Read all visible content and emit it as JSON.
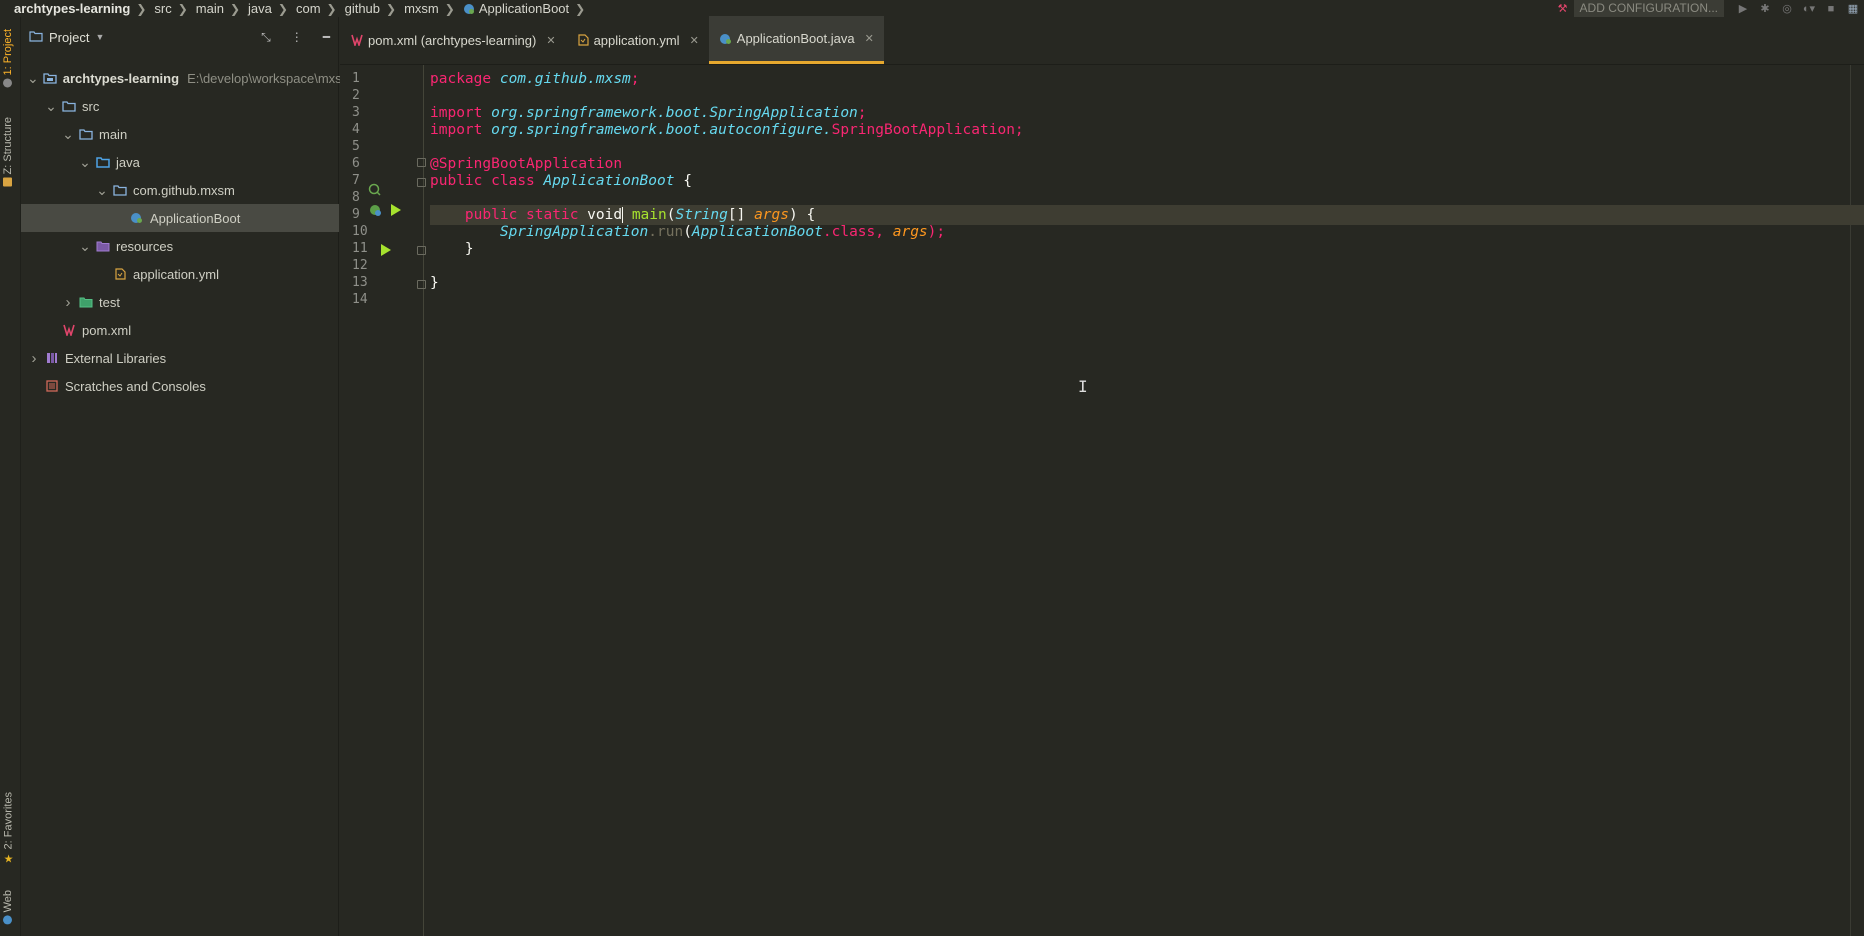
{
  "breadcrumb": [
    "archtypes-learning",
    "src",
    "main",
    "java",
    "com",
    "github",
    "mxsm",
    "ApplicationBoot"
  ],
  "toolbar": {
    "add_configuration": "ADD CONFIGURATION..."
  },
  "left_strip": {
    "project_tab": "1: Project",
    "structure_tab": "Z: Structure",
    "favorites_tab": "2: Favorites",
    "web_tab": "Web"
  },
  "project_panel": {
    "title": "Project",
    "tree": [
      {
        "label": "archtypes-learning",
        "path": "E:\\develop\\workspace\\mxs",
        "indent": 0,
        "arrow": "down",
        "icon": "module-folder-icon"
      },
      {
        "label": "src",
        "indent": 1,
        "arrow": "down",
        "icon": "folder-icon"
      },
      {
        "label": "main",
        "indent": 2,
        "arrow": "down",
        "icon": "folder-icon"
      },
      {
        "label": "java",
        "indent": 3,
        "arrow": "down",
        "icon": "source-folder-icon"
      },
      {
        "label": "com.github.mxsm",
        "indent": 4,
        "arrow": "down",
        "icon": "package-icon"
      },
      {
        "label": "ApplicationBoot",
        "indent": 5,
        "arrow": "none",
        "icon": "spring-class-icon",
        "selected": true
      },
      {
        "label": "resources",
        "indent": 3,
        "arrow": "down",
        "icon": "resources-folder-icon"
      },
      {
        "label": "application.yml",
        "indent": 4,
        "arrow": "none",
        "icon": "yaml-file-icon"
      },
      {
        "label": "test",
        "indent": 2,
        "arrow": "right",
        "icon": "test-folder-icon"
      },
      {
        "label": "pom.xml",
        "indent": 1,
        "arrow": "none",
        "icon": "maven-icon"
      },
      {
        "label": "External Libraries",
        "indent": 0,
        "arrow": "right",
        "icon": "libraries-icon"
      },
      {
        "label": "Scratches and Consoles",
        "indent": 0,
        "arrow": "none",
        "icon": "scratches-icon"
      }
    ]
  },
  "tabs": [
    {
      "label": "pom.xml (archtypes-learning)",
      "icon": "maven-icon",
      "active": false
    },
    {
      "label": "application.yml",
      "icon": "yaml-file-icon",
      "active": false
    },
    {
      "label": "ApplicationBoot.java",
      "icon": "spring-class-icon",
      "active": true
    }
  ],
  "line_numbers": [
    "1",
    "2",
    "3",
    "4",
    "5",
    "6",
    "7",
    "8",
    "9",
    "10",
    "11",
    "12",
    "13",
    "14"
  ],
  "code": {
    "l1_kw": "package",
    "l1_pkg": "com.github.mxsm",
    "l1_semi": ";",
    "l3_kw": "import",
    "l3_pkg": "org.springframework.boot.",
    "l3_cls": "SpringApplication",
    "l3_semi": ";",
    "l4_kw": "import",
    "l4_pkg": "org.springframework.boot.autoconfigure.",
    "l4_cls": "SpringBootApplication",
    "l4_semi": ";",
    "l6_ann": "@SpringBootApplication",
    "l7_kw1": "public",
    "l7_kw2": "class",
    "l7_name": "ApplicationBoot",
    "l7_brace": "{",
    "l9_kw1": "public",
    "l9_kw2": "static",
    "l9_void": "void",
    "l9_fn": "main",
    "l9_p1": "(",
    "l9_type": "String",
    "l9_arr": "[] ",
    "l9_arg": "args",
    "l9_p2": ") {",
    "l10_cls": "SpringApplication",
    "l10_dot": ".",
    "l10_run": "run",
    "l10_p1": "(",
    "l10_cls2": "ApplicationBoot",
    "l10_class": ".class",
    "l10_comma": ", ",
    "l10_arg": "args",
    "l10_end": ");",
    "l11": "}",
    "l13": "}"
  },
  "colors": {
    "accent": "#e6a82e",
    "keyword": "#f92672",
    "type": "#66d9ef",
    "function": "#a6e22e",
    "param": "#fd971f"
  }
}
